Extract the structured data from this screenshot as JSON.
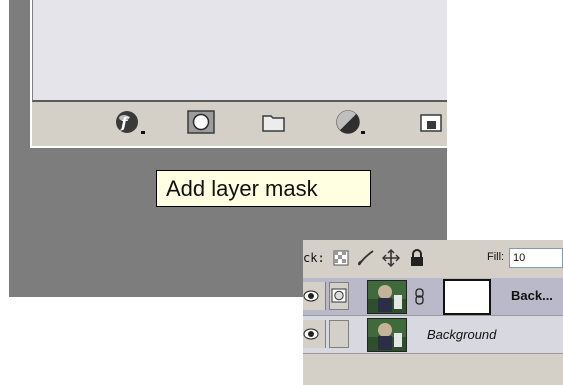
{
  "tooltip": {
    "text": "Add layer mask"
  },
  "toolbar": {
    "buttons": [
      {
        "name": "layer-style-button",
        "icon": "fx-icon"
      },
      {
        "name": "add-layer-mask-button",
        "icon": "layer-mask-icon"
      },
      {
        "name": "new-group-button",
        "icon": "folder-icon"
      },
      {
        "name": "adjustment-layer-button",
        "icon": "half-circle-icon"
      },
      {
        "name": "new-layer-button",
        "icon": "new-layer-icon"
      }
    ]
  },
  "lock_bar": {
    "lock_label": "ck:",
    "fill_label": "Fill:",
    "fill_value": "10"
  },
  "layers": [
    {
      "name": "Back...",
      "style": "bold",
      "has_mask": true,
      "selected": true
    },
    {
      "name": "Background",
      "style": "italic",
      "has_mask": false,
      "selected": false
    }
  ],
  "colors": {
    "canvas_bg": "#7d7d7d",
    "panel_bg": "#d4d0c8",
    "tooltip_bg": "#ffffe1",
    "selected_row": "#b9b9c9"
  }
}
